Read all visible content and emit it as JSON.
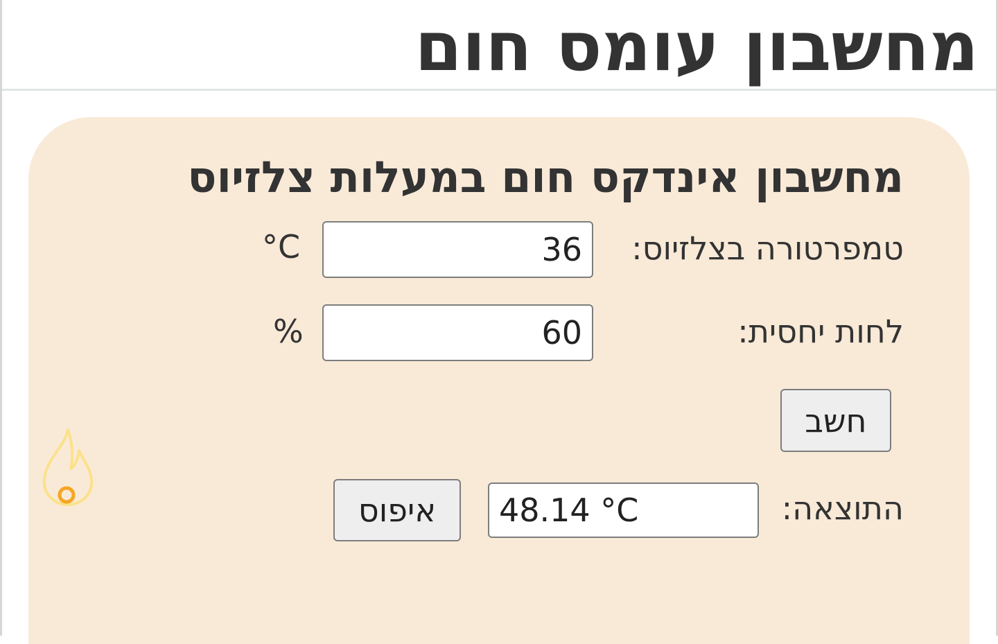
{
  "page": {
    "title": "מחשבון עומס חום"
  },
  "calculator": {
    "heading": "מחשבון אינדקס חום במעלות צלזיוס",
    "temperature": {
      "label": "טמפרטורה בצלזיוס:",
      "value": "36",
      "unit": "°C"
    },
    "humidity": {
      "label": "לחות יחסית:",
      "value": "60",
      "unit": "%"
    },
    "calculate_label": "חשב",
    "result": {
      "label": "התוצאה:",
      "value": "48.14 °C"
    },
    "reset_label": "איפוס"
  },
  "icons": {
    "flame": "flame-icon"
  },
  "colors": {
    "card_background": "#f9ead8",
    "flame_outline": "#fbe18a",
    "flame_ring": "#f5a623"
  }
}
